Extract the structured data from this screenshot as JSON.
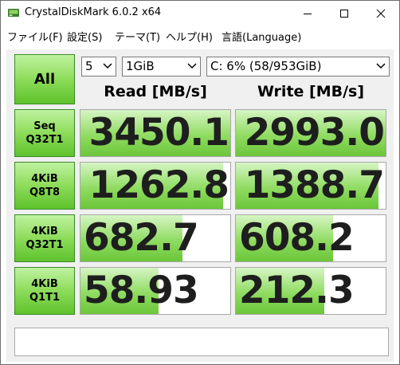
{
  "window": {
    "title": "CrystalDiskMark 6.0.2 x64"
  },
  "menu": [
    {
      "label": "ファイル(F)"
    },
    {
      "label": "設定(S)"
    },
    {
      "label": "テーマ(T)"
    },
    {
      "label": "ヘルプ(H)"
    },
    {
      "label": "言語(Language)"
    }
  ],
  "controls": {
    "all_label": "All",
    "count": "5",
    "size": "1GiB",
    "drive": "C: 6% (58/953GiB)"
  },
  "headers": {
    "read": "Read [MB/s]",
    "write": "Write [MB/s]"
  },
  "rows": [
    {
      "label1": "Seq",
      "label2": "Q32T1",
      "read": "3450.1",
      "write": "2993.0",
      "read_fill": 1.0,
      "write_fill": 1.0
    },
    {
      "label1": "4KiB",
      "label2": "Q8T8",
      "read": "1262.8",
      "write": "1388.7",
      "read_fill": 0.95,
      "write_fill": 0.95
    },
    {
      "label1": "4KiB",
      "label2": "Q32T1",
      "read": "682.7",
      "write": "608.2",
      "read_fill": 0.68,
      "write_fill": 0.65
    },
    {
      "label1": "4KiB",
      "label2": "Q1T1",
      "read": "58.93",
      "write": "212.3",
      "read_fill": 0.52,
      "write_fill": 0.59
    }
  ],
  "status_text": "",
  "colors": {
    "accent_green": "#8ddc5a",
    "border_green": "#3a8a2a"
  }
}
